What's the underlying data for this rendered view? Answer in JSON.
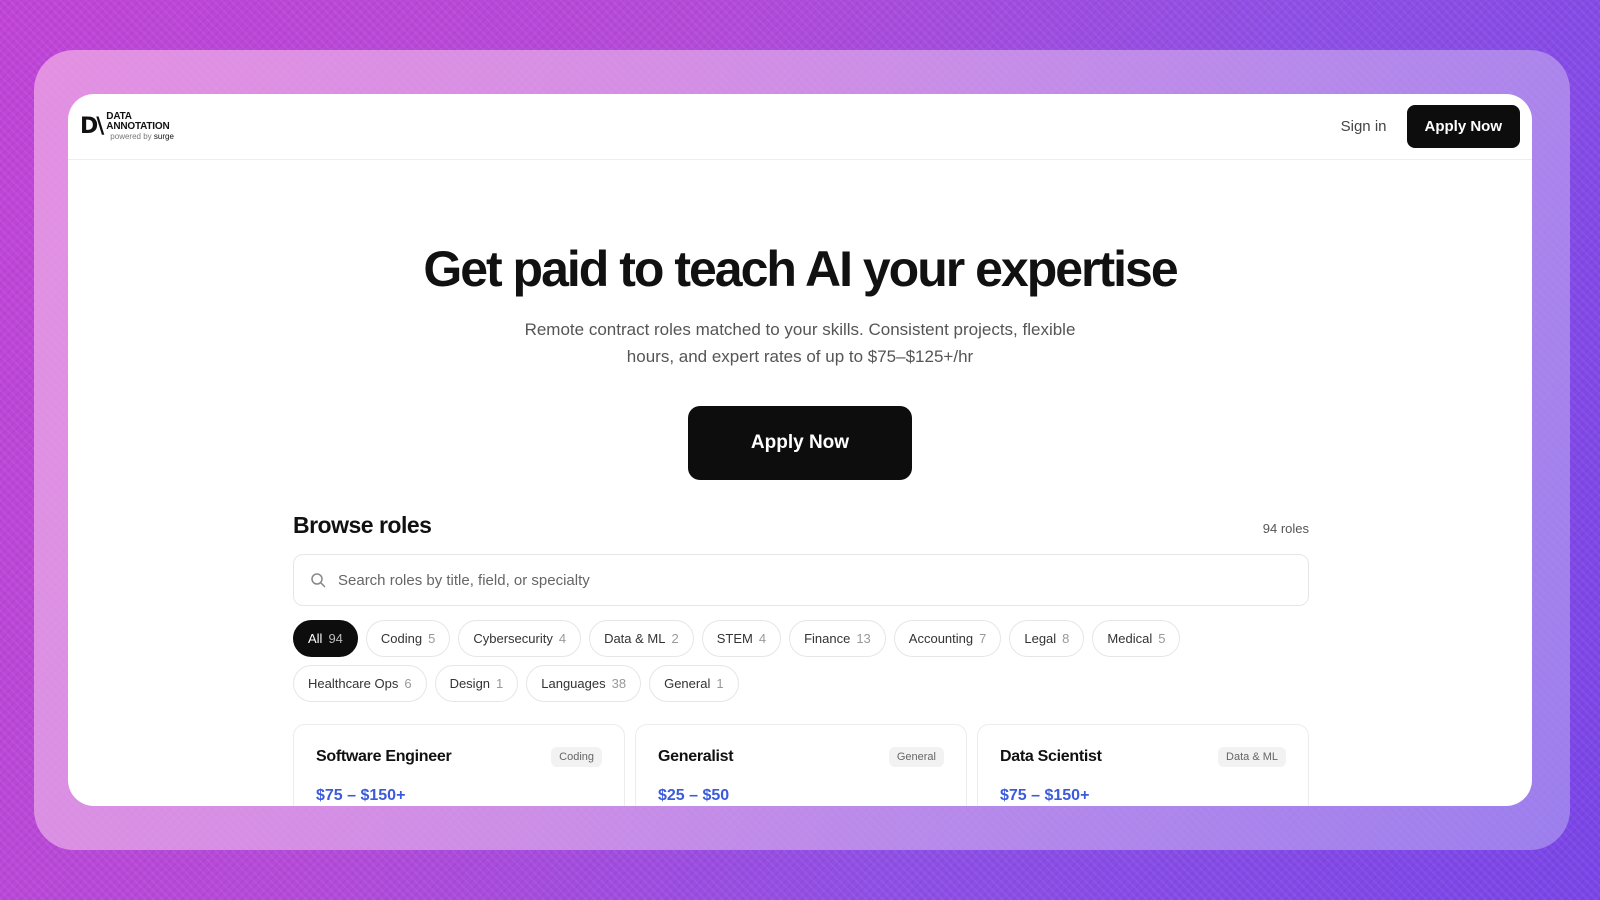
{
  "brand": {
    "mark": "D\\",
    "line1": "DATA",
    "line2": "ANNOTATION",
    "powered": "powered by",
    "surge": "surge"
  },
  "nav": {
    "signin": "Sign in",
    "apply": "Apply Now"
  },
  "hero": {
    "title": "Get paid to teach AI your expertise",
    "subtitle": "Remote contract roles matched to your skills. Consistent projects, flexible hours, and expert rates of up to $75–$125+/hr",
    "cta": "Apply Now"
  },
  "browse": {
    "title": "Browse roles",
    "count": "94 roles",
    "search_placeholder": "Search roles by title, field, or specialty",
    "filters": [
      {
        "label": "All",
        "count": "94",
        "active": true
      },
      {
        "label": "Coding",
        "count": "5"
      },
      {
        "label": "Cybersecurity",
        "count": "4"
      },
      {
        "label": "Data & ML",
        "count": "2"
      },
      {
        "label": "STEM",
        "count": "4"
      },
      {
        "label": "Finance",
        "count": "13"
      },
      {
        "label": "Accounting",
        "count": "7"
      },
      {
        "label": "Legal",
        "count": "8"
      },
      {
        "label": "Medical",
        "count": "5"
      },
      {
        "label": "Healthcare Ops",
        "count": "6"
      },
      {
        "label": "Design",
        "count": "1"
      },
      {
        "label": "Languages",
        "count": "38"
      },
      {
        "label": "General",
        "count": "1"
      }
    ],
    "cards": [
      {
        "title": "Software Engineer",
        "tag": "Coding",
        "pay": "$75 – $150+"
      },
      {
        "title": "Generalist",
        "tag": "General",
        "pay": "$25 – $50"
      },
      {
        "title": "Data Scientist",
        "tag": "Data & ML",
        "pay": "$75 – $150+"
      }
    ]
  }
}
